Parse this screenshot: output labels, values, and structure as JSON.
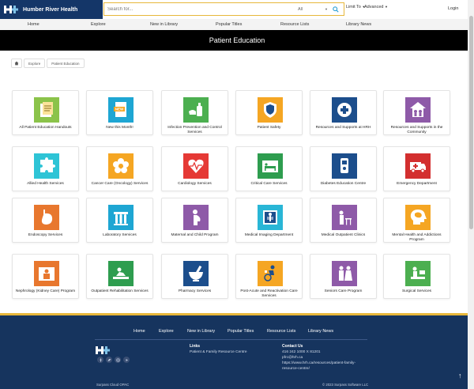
{
  "header": {
    "brand": "Humber River Health",
    "search_placeholder": "Search for...",
    "search_scope": "All",
    "limit_to": "Limit To",
    "advanced": "Advanced",
    "login": "Login"
  },
  "nav": [
    "Home",
    "Explore",
    "New in Library",
    "Popular Titles",
    "Resource Lists",
    "Library News"
  ],
  "banner": {
    "title": "Patient Education"
  },
  "breadcrumb": {
    "explore": "Explore",
    "current": "Patient Education"
  },
  "cards": [
    {
      "label": "All Patient Education Handouts",
      "icon": "handouts-icon",
      "color": "#8bc34a"
    },
    {
      "label": "New this Month!",
      "icon": "new-document-icon",
      "color": "#1ea6d3"
    },
    {
      "label": "Infection Prevention and Control Services",
      "icon": "hand-sanitizer-icon",
      "color": "#4caf50"
    },
    {
      "label": "Patient Safety",
      "icon": "shield-hand-icon",
      "color": "#f5a623"
    },
    {
      "label": "Resources and Supports at HRH",
      "icon": "medical-kit-icon",
      "color": "#1c4e8c"
    },
    {
      "label": "Resources and Supports in the Community",
      "icon": "community-house-icon",
      "color": "#8e5aa8"
    },
    {
      "label": "Allied Health Services",
      "icon": "puzzle-icon",
      "color": "#2ec4d6"
    },
    {
      "label": "Cancer Care (Oncology) Services",
      "icon": "flower-icon",
      "color": "#f5a623"
    },
    {
      "label": "Cardiology Services",
      "icon": "heart-pulse-icon",
      "color": "#e53935"
    },
    {
      "label": "Critical Care Services",
      "icon": "hospital-bed-icon",
      "color": "#2e9d4f"
    },
    {
      "label": "Diabetes Education Centre",
      "icon": "glucose-meter-icon",
      "color": "#1c4e8c"
    },
    {
      "label": "Emergency Department",
      "icon": "ambulance-icon",
      "color": "#d32f2f"
    },
    {
      "label": "Endoscopy Services",
      "icon": "stomach-icon",
      "color": "#e8772e"
    },
    {
      "label": "Laboratory Services",
      "icon": "test-tubes-icon",
      "color": "#1ea6d3"
    },
    {
      "label": "Maternal and Child Program",
      "icon": "pregnant-icon",
      "color": "#8e5aa8"
    },
    {
      "label": "Medical Imaging Department",
      "icon": "xray-icon",
      "color": "#29b6d6"
    },
    {
      "label": "Medical Outpatient Clinics",
      "icon": "clinic-icon",
      "color": "#8e5aa8"
    },
    {
      "label": "Mental Health and Addictions Program",
      "icon": "brain-head-icon",
      "color": "#f5a623"
    },
    {
      "label": "Nephrology (Kidney Care) Program",
      "icon": "kidney-patient-icon",
      "color": "#e8772e"
    },
    {
      "label": "Outpatient Rehabilitation Services",
      "icon": "rehab-icon",
      "color": "#2e9d4f"
    },
    {
      "label": "Pharmacy Services",
      "icon": "mortar-pestle-icon",
      "color": "#1c4e8c"
    },
    {
      "label": "Post-Acute and Reactivation Care Services",
      "icon": "wheelchair-icon",
      "color": "#f5a623"
    },
    {
      "label": "Seniors Care Program",
      "icon": "seniors-icon",
      "color": "#8e5aa8"
    },
    {
      "label": "Surgical Services",
      "icon": "surgery-icon",
      "color": "#4caf50"
    }
  ],
  "footer": {
    "nav": [
      "Home",
      "Explore",
      "New in Library",
      "Popular Titles",
      "Resource Lists",
      "Library News"
    ],
    "links_title": "Links",
    "links": [
      "Patient & Family Resource Centre"
    ],
    "contact_title": "Contact Us",
    "phone": "416 242 1000 X 81201",
    "email": "pfrc@hrh.ca",
    "url_line1": "https://www.hrh.ca/resources/patient-family-",
    "url_line2": "resource-centre/",
    "bottom_left": "Surpass Cloud OPAC",
    "bottom_right": "© 2023 Surpass Software LLC",
    "social": [
      "facebook-icon",
      "twitter-icon",
      "instagram-icon",
      "youtube-icon"
    ]
  }
}
